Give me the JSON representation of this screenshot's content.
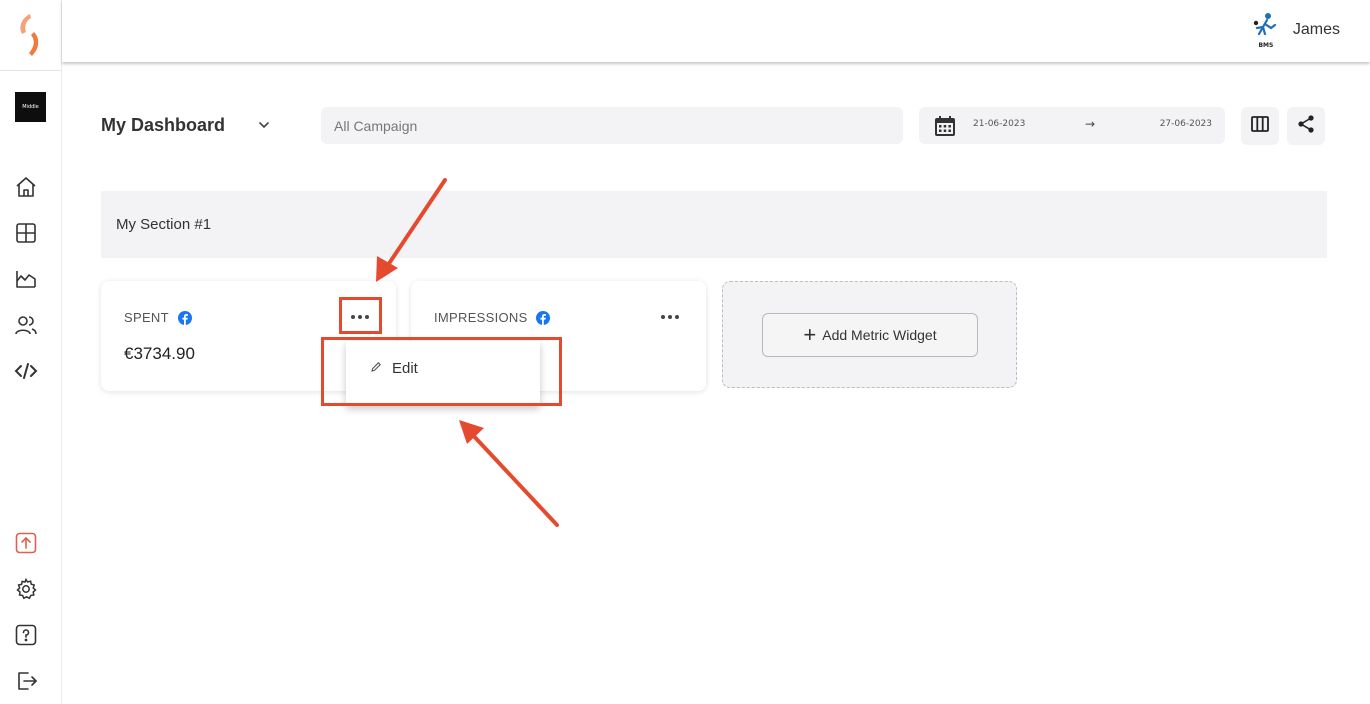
{
  "header": {
    "user_name": "James",
    "avatar_label": "BMS"
  },
  "sidebar": {
    "brand_thumb_label": "Middle",
    "items": [
      {
        "icon": "home-icon"
      },
      {
        "icon": "dashboard-grid-icon"
      },
      {
        "icon": "area-chart-icon"
      },
      {
        "icon": "users-icon"
      },
      {
        "icon": "code-icon"
      },
      {
        "icon": "upload-icon"
      },
      {
        "icon": "gear-icon"
      },
      {
        "icon": "help-icon"
      },
      {
        "icon": "logout-icon"
      }
    ]
  },
  "toolbar": {
    "dashboard_title": "My Dashboard",
    "campaign_placeholder": "All Campaign",
    "date_from": "21-06-2023",
    "date_arrow": "→",
    "date_to": "27-06-2023"
  },
  "section": {
    "title": "My Section #1"
  },
  "cards": [
    {
      "title": "SPENT",
      "value": "€3734.90",
      "icon": "facebook-icon"
    },
    {
      "title": "IMPRESSIONS",
      "value": "",
      "icon": "facebook-icon"
    }
  ],
  "add_widget": {
    "plus": "+",
    "label": "Add Metric Widget"
  },
  "dropdown": {
    "items": [
      {
        "label": "Edit",
        "icon": "pencil-icon"
      }
    ]
  },
  "colors": {
    "accent_orange": "#f08a4b",
    "annotation_red": "#e64a2e",
    "panel_gray": "#f3f3f5",
    "facebook_blue": "#1877f2"
  }
}
